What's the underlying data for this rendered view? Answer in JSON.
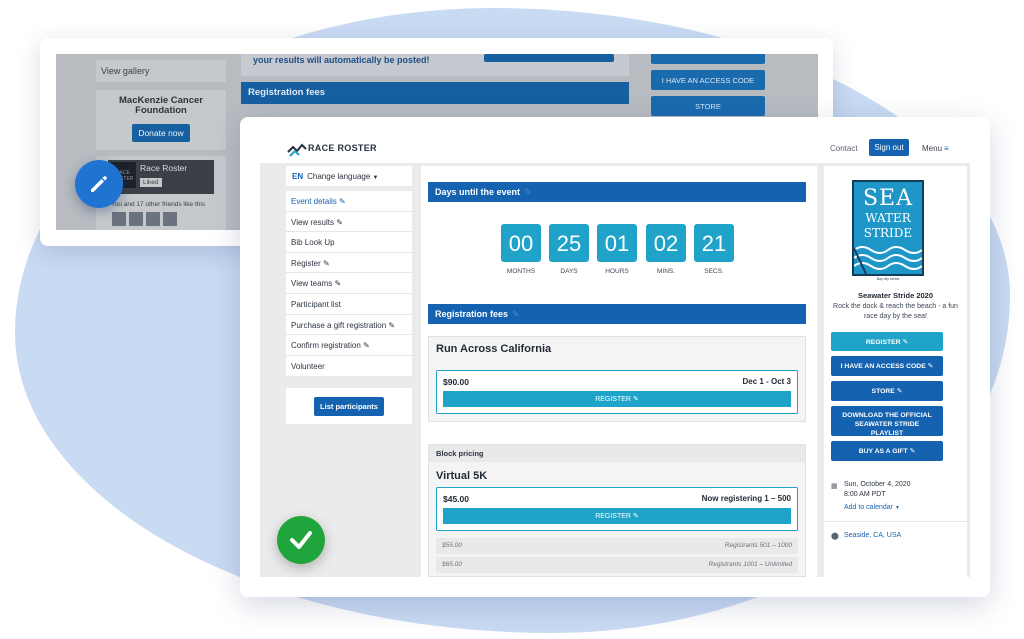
{
  "back_window": {
    "view_gallery": "View gallery",
    "foundation_name": "MacKenzie Cancer Foundation",
    "donate_label": "Donate now",
    "fb_page_name": "Race Roster",
    "fb_logo_text": "RACE ROSTER",
    "fb_liked": "Liked",
    "fb_friends": "You and 17 other friends like this",
    "results_notice": "your results will automatically be posted!",
    "registration_fees": "Registration fees",
    "side_buttons": [
      "I HAVE AN ACCESS CODE",
      "STORE"
    ]
  },
  "header": {
    "brand": "RACE ROSTER",
    "contact": "Contact",
    "sign_out": "Sign out",
    "menu": "Menu",
    "menu_icon": "hamburger-icon"
  },
  "sidebar": {
    "lang_code": "EN",
    "lang_label": "Change language",
    "items": [
      {
        "label": "Event details",
        "pencil": true
      },
      {
        "label": "View results",
        "pencil": true
      },
      {
        "label": "Bib Look Up",
        "pencil": false
      },
      {
        "label": "Register",
        "pencil": true
      },
      {
        "label": "View teams",
        "pencil": true
      },
      {
        "label": "Participant list",
        "pencil": false
      },
      {
        "label": "Purchase a gift registration",
        "pencil": true
      },
      {
        "label": "Confirm registration",
        "pencil": true
      },
      {
        "label": "Volunteer",
        "pencil": false
      }
    ],
    "list_participants": "List participants"
  },
  "countdown": {
    "heading": "Days until the event",
    "values": [
      "00",
      "25",
      "01",
      "02",
      "21"
    ],
    "labels": [
      "MONTHS",
      "DAYS",
      "HOURS",
      "MINS.",
      "SECS."
    ]
  },
  "registration": {
    "heading": "Registration fees",
    "race1": {
      "title": "Run Across California",
      "price": "$90.00",
      "dates": "Dec 1 - Oct 3",
      "register": "REGISTER"
    },
    "race2": {
      "tag": "Block pricing",
      "title": "Virtual 5K",
      "price": "$45.00",
      "status": "Now registering 1 – 500",
      "register": "REGISTER",
      "tiers": [
        {
          "price": "$55.00",
          "range": "Registrants 501 – 1000"
        },
        {
          "price": "$65.00",
          "range": "Registrants 1001 – Unlimited"
        }
      ]
    }
  },
  "event": {
    "logo_line1": "SEA",
    "logo_line2": "WATER",
    "logo_line3": "STRIDE",
    "logo_sub": "Bay city series",
    "name": "Seawater Stride 2020",
    "description": "Rock the dock & reach the beach - a fun race day by the sea!",
    "buttons": [
      "REGISTER",
      "I HAVE AN ACCESS CODE",
      "STORE",
      "DOWNLOAD THE OFFICIAL SEAWATER STRIDE PLAYLIST",
      "BUY AS A GIFT"
    ],
    "date": "Sun, October 4, 2020",
    "time": "8:00 AM PDT",
    "add_to_calendar": "Add to calendar",
    "location": "Seaside, CA, USA"
  },
  "colors": {
    "brand_blue": "#1562b0",
    "teal": "#1fa3c9",
    "success": "#1fa53c",
    "fab_blue": "#1f74d1"
  }
}
